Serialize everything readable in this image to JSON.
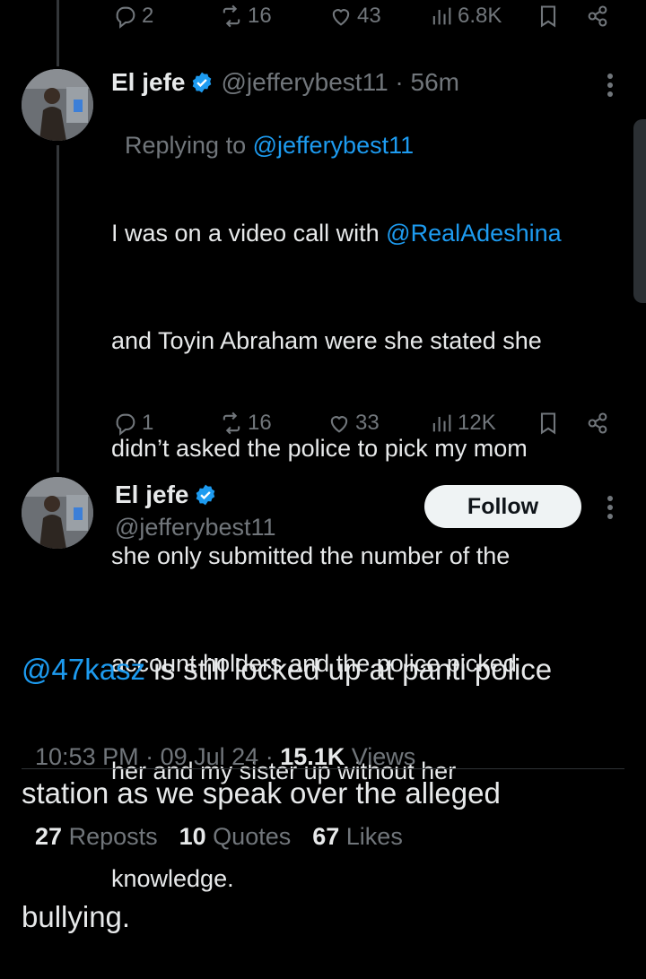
{
  "top_actions": {
    "replies": "2",
    "reposts": "16",
    "likes": "43",
    "views": "6.8K"
  },
  "reply_tweet": {
    "author_name": "El jefe",
    "handle": "@jefferybest11",
    "separator": " · ",
    "time": "56m",
    "replying_prefix": "Replying to ",
    "replying_handle": "@jefferybest11",
    "lines": [
      [
        "I was on a video call with ",
        "@RealAdeshina"
      ],
      [
        "and Toyin Abraham were she stated she"
      ],
      [
        "didn’t asked the police to pick my mom"
      ],
      [
        "she only submitted the number of the"
      ],
      [
        "account holders and the police picked"
      ],
      [
        "her and my sister up without her"
      ],
      [
        "knowledge."
      ]
    ],
    "actions": {
      "replies": "1",
      "reposts": "16",
      "likes": "33",
      "views": "12K"
    }
  },
  "main_tweet": {
    "author_name": "El jefe",
    "handle": "@jefferybest11",
    "follow_label": "Follow",
    "text_mention": "@47kasz",
    "text_line1_rest": " is still locked up at panti police",
    "text_line2": "station as we speak over the alleged",
    "text_line3": "bullying.",
    "time": "10:53 PM",
    "date": "09 Jul 24",
    "dot": " · ",
    "views_count": "15.1K",
    "views_label": " Views"
  },
  "stats": {
    "reposts_count": "27",
    "reposts_label": " Reposts",
    "quotes_count": "10",
    "quotes_label": " Quotes",
    "likes_count": "67",
    "likes_label": " Likes"
  },
  "colors": {
    "accent": "#1d9bf0",
    "muted": "#71767b",
    "text": "#e7e9ea",
    "background": "#000000"
  },
  "icons": [
    "reply-icon",
    "repost-icon",
    "like-icon",
    "views-icon",
    "bookmark-icon",
    "share-icon",
    "verified-badge-icon",
    "more-icon"
  ]
}
